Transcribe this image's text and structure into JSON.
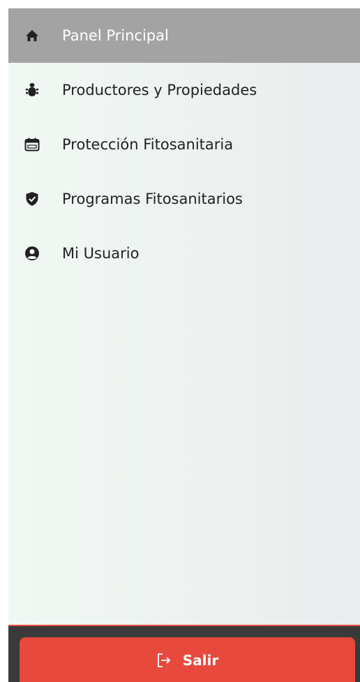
{
  "sidebar": {
    "items": [
      {
        "label": "Panel Principal",
        "icon": "home-icon",
        "active": true
      },
      {
        "label": "Productores y Propiedades",
        "icon": "bug-icon",
        "active": false
      },
      {
        "label": "Protección Fitosanitaria",
        "icon": "calendar-icon",
        "active": false
      },
      {
        "label": "Programas Fitosanitarios",
        "icon": "shield-check-icon",
        "active": false
      },
      {
        "label": "Mi Usuario",
        "icon": "user-circle-icon",
        "active": false
      }
    ]
  },
  "footer": {
    "logout_label": "Salir",
    "logout_icon": "sign-out-icon"
  },
  "colors": {
    "active_bg": "#a3a3a3",
    "logout_bg": "#e7493c",
    "footer_bg": "#3a3a3a",
    "text": "#222222"
  }
}
